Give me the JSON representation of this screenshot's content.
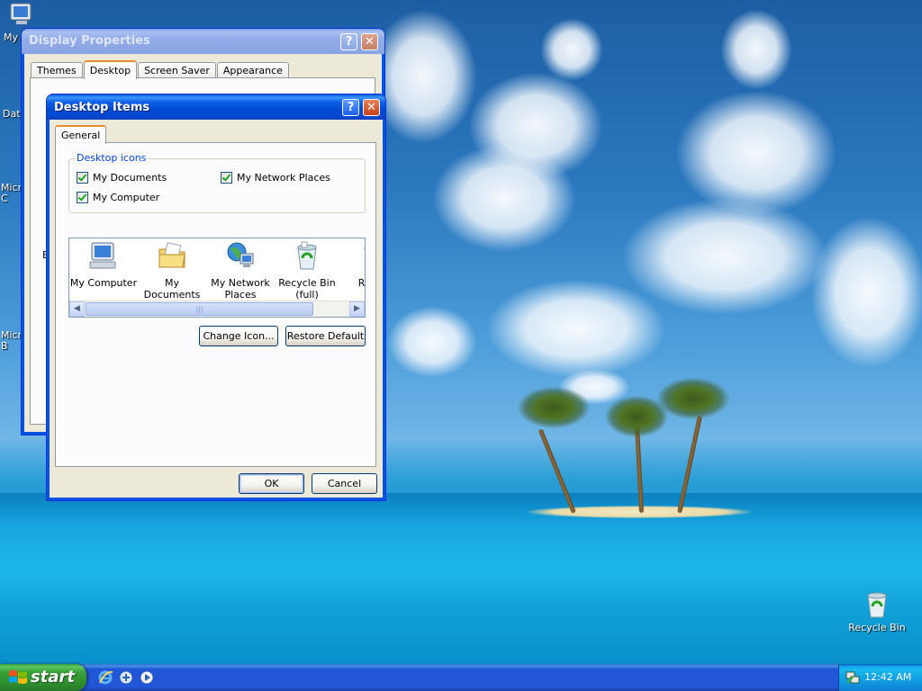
{
  "desktop": {
    "icons": [
      {
        "label": "My"
      },
      {
        "label": "Dat"
      },
      {
        "label": "Micr C"
      },
      {
        "label": "Micr B"
      },
      {
        "label": "Recycle Bin"
      }
    ]
  },
  "display_properties": {
    "title": "Display Properties",
    "tabs": [
      "Themes",
      "Desktop",
      "Screen Saver",
      "Appearance"
    ],
    "active_tab": "Desktop",
    "partial_label": "B"
  },
  "desktop_items": {
    "title": "Desktop Items",
    "tab": "General",
    "group_label": "Desktop icons",
    "checkboxes": [
      {
        "label": "My Documents",
        "checked": true
      },
      {
        "label": "My Network Places",
        "checked": true
      },
      {
        "label": "My Computer",
        "checked": true
      }
    ],
    "list_items": [
      {
        "label": "My Computer",
        "icon": "my-computer-icon"
      },
      {
        "label": "My Documents",
        "icon": "my-documents-icon"
      },
      {
        "label": "My Network Places",
        "icon": "network-places-icon"
      },
      {
        "label": "Recycle Bin (full)",
        "icon": "recycle-bin-full-icon"
      },
      {
        "label": "Rec (e",
        "icon": "recycle-bin-empty-icon"
      }
    ],
    "buttons": {
      "change_icon": "Change Icon...",
      "restore_default": "Restore Default",
      "ok": "OK",
      "cancel": "Cancel"
    }
  },
  "taskbar": {
    "start_label": "start",
    "quick_launch": [
      "internet-explorer-icon",
      "outlook-express-icon",
      "media-player-icon"
    ],
    "clock": "12:42 AM"
  }
}
